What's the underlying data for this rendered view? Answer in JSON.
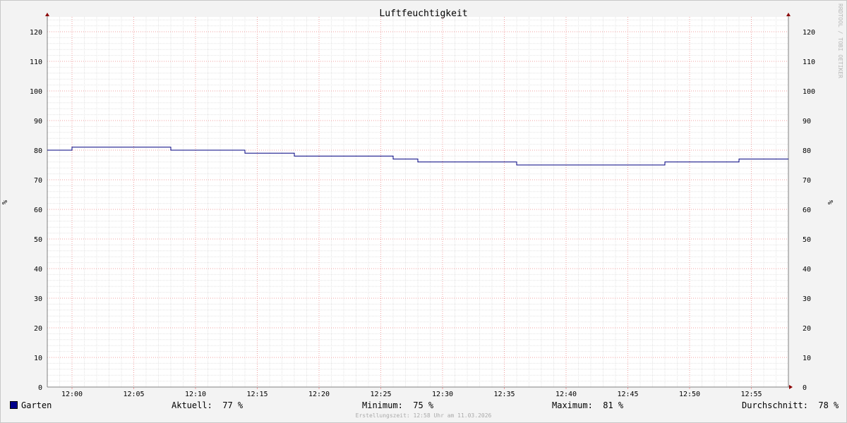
{
  "chart_data": {
    "type": "line",
    "title": "Luftfeuchtigkeit",
    "ylabel": "%",
    "right_ylabel": "%",
    "ylim": [
      0,
      125
    ],
    "yticks": [
      0,
      10,
      20,
      30,
      40,
      50,
      60,
      70,
      80,
      90,
      100,
      110,
      120
    ],
    "x_tick_labels": [
      "12:00",
      "12:05",
      "12:10",
      "12:15",
      "12:20",
      "12:25",
      "12:30",
      "12:35",
      "12:40",
      "12:45",
      "12:50",
      "12:55"
    ],
    "xlim": [
      "11:58",
      "12:58"
    ],
    "grid": true,
    "series": [
      {
        "name": "Garten",
        "color": "#000080",
        "step": true,
        "points": [
          [
            "11:58",
            80
          ],
          [
            "12:00",
            81
          ],
          [
            "12:08",
            80
          ],
          [
            "12:14",
            79
          ],
          [
            "12:18",
            78
          ],
          [
            "12:26",
            77
          ],
          [
            "12:28",
            76
          ],
          [
            "12:36",
            75
          ],
          [
            "12:48",
            76
          ],
          [
            "12:54",
            77
          ],
          [
            "12:58",
            77
          ]
        ]
      }
    ],
    "watermark": "RRDTOOL / TOBI OETIKER"
  },
  "legend": {
    "series_name": "Garten",
    "current_label": "Aktuell:",
    "current_value": "77 %",
    "min_label": "Minimum:",
    "min_value": "75 %",
    "max_label": "Maximum:",
    "max_value": "81 %",
    "avg_label": "Durchschnitt:",
    "avg_value": "78 %"
  },
  "footer": "Erstellungszeit: 12:58 Uhr am 11.03.2026"
}
